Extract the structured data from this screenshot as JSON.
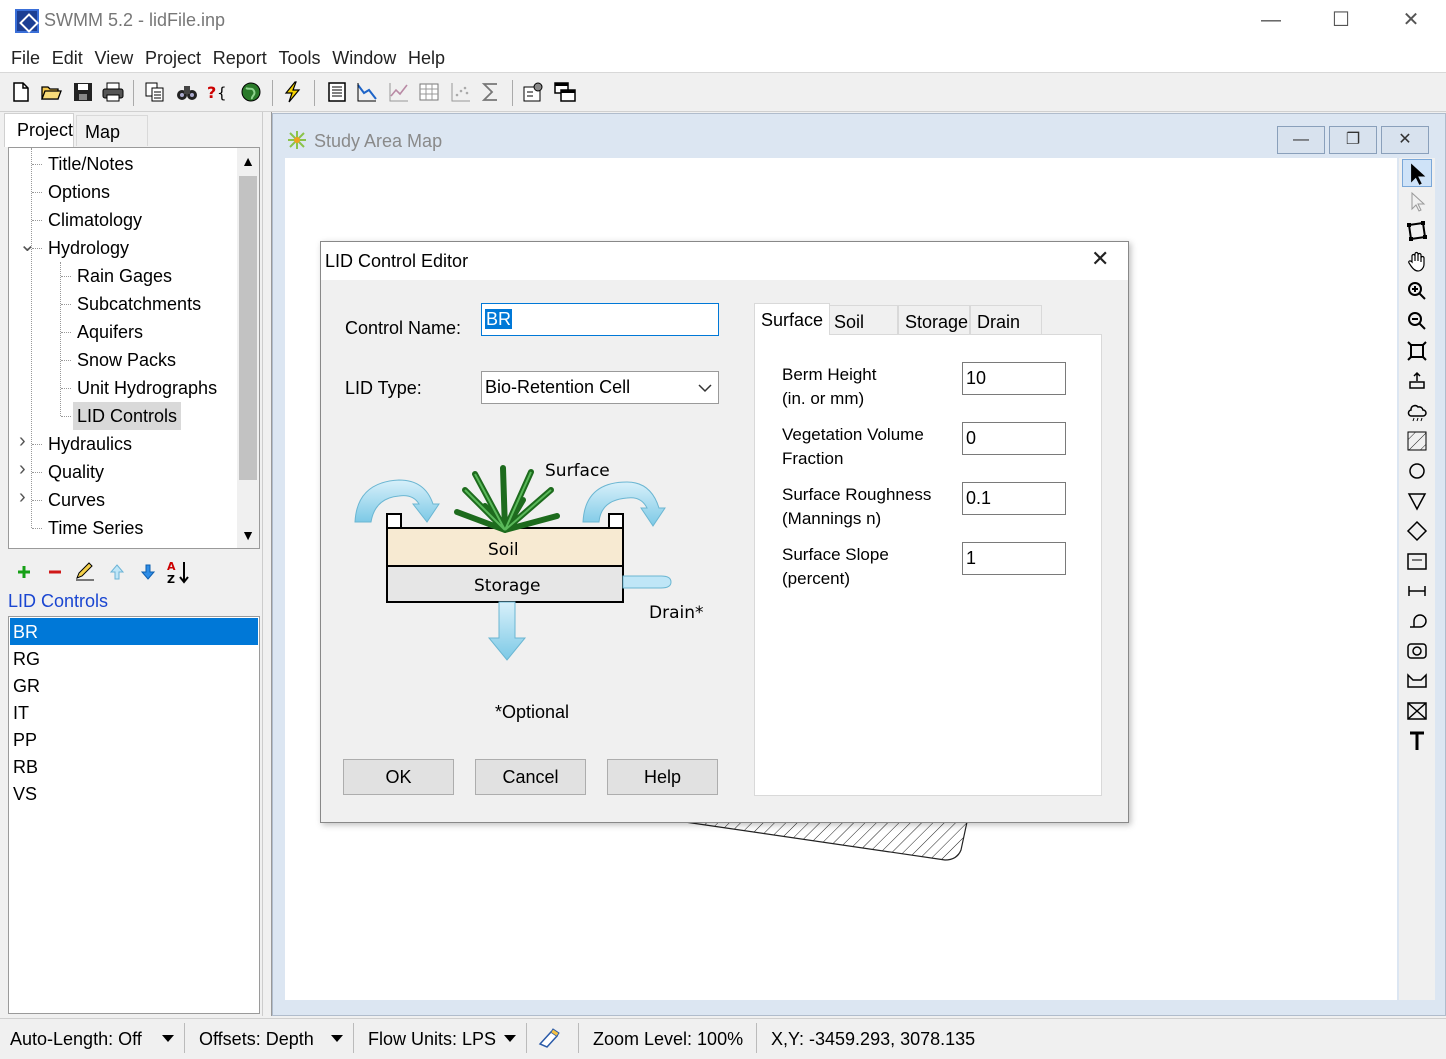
{
  "window": {
    "title": "SWMM 5.2 - lidFile.inp",
    "minimize": "—",
    "maximize": "☐",
    "close": "✕"
  },
  "menu": [
    "File",
    "Edit",
    "View",
    "Project",
    "Report",
    "Tools",
    "Window",
    "Help"
  ],
  "toolbar_icons": [
    "new-file-icon",
    "open-folder-icon",
    "save-icon",
    "print-icon",
    "copy-icon",
    "find-icon",
    "query-icon",
    "overview-map-icon",
    "run-icon",
    "status-report-icon",
    "profile-plot-icon",
    "time-series-plot-icon",
    "table-icon",
    "scatter-plot-icon",
    "statistics-icon",
    "options-icon",
    "arrange-windows-icon"
  ],
  "left_panel": {
    "tabs": [
      "Project",
      "Map"
    ],
    "tree": [
      {
        "label": "Title/Notes",
        "level": 0
      },
      {
        "label": "Options",
        "level": 0
      },
      {
        "label": "Climatology",
        "level": 0
      },
      {
        "label": "Hydrology",
        "level": 0,
        "expanded": true
      },
      {
        "label": "Rain Gages",
        "level": 1
      },
      {
        "label": "Subcatchments",
        "level": 1
      },
      {
        "label": "Aquifers",
        "level": 1
      },
      {
        "label": "Snow Packs",
        "level": 1
      },
      {
        "label": "Unit Hydrographs",
        "level": 1
      },
      {
        "label": "LID Controls",
        "level": 1,
        "selected": true
      },
      {
        "label": "Hydraulics",
        "level": 0,
        "expandable": true
      },
      {
        "label": "Quality",
        "level": 0,
        "expandable": true
      },
      {
        "label": "Curves",
        "level": 0,
        "expandable": true
      },
      {
        "label": "Time Series",
        "level": 0
      }
    ],
    "object_toolbar": [
      "add-icon",
      "delete-icon",
      "edit-icon",
      "move-up-icon",
      "move-down-icon",
      "sort-icon"
    ],
    "list_title": "LID Controls",
    "list_items": [
      "BR",
      "RG",
      "GR",
      "IT",
      "PP",
      "RB",
      "VS"
    ],
    "selected_item": "BR"
  },
  "map_window": {
    "title": "Study Area Map",
    "minimize": "—",
    "restore": "❐",
    "close": "✕",
    "tools": [
      "select-object-icon",
      "select-vertex-icon",
      "select-region-icon",
      "pan-icon",
      "zoom-in-icon",
      "zoom-out-icon",
      "full-extent-icon",
      "rain-gage-icon",
      "subcatchment-cloud-icon",
      "subcatchment-icon",
      "junction-icon",
      "outfall-icon",
      "divider-icon",
      "storage-icon",
      "conduit-icon",
      "pump-icon",
      "orifice-icon",
      "weir-icon",
      "outlet-icon",
      "label-icon"
    ]
  },
  "dialog": {
    "title": "LID Control Editor",
    "close": "✕",
    "control_name_label": "Control Name:",
    "control_name_value": "BR",
    "lid_type_label": "LID Type:",
    "lid_type_value": "Bio-Retention Cell",
    "diagram": {
      "surface": "Surface",
      "soil": "Soil",
      "storage": "Storage",
      "drain": "Drain*",
      "note": "*Optional"
    },
    "buttons": {
      "ok": "OK",
      "cancel": "Cancel",
      "help": "Help"
    },
    "tabs": [
      "Surface",
      "Soil",
      "Storage",
      "Drain"
    ],
    "active_tab": "Surface",
    "params": [
      {
        "label": "Berm Height",
        "unit": "(in. or mm)",
        "value": "10"
      },
      {
        "label": "Vegetation Volume",
        "unit": "Fraction",
        "value": "0"
      },
      {
        "label": "Surface Roughness",
        "unit": "(Mannings n)",
        "value": "0.1"
      },
      {
        "label": "Surface Slope",
        "unit": "(percent)",
        "value": "1"
      }
    ]
  },
  "status_bar": {
    "auto_length": "Auto-Length: Off",
    "offsets": "Offsets: Depth",
    "flow_units": "Flow Units: LPS",
    "zoom": "Zoom Level: 100%",
    "xy": "X,Y: -3459.293, 3078.135"
  },
  "colors": {
    "selection": "#0078d7",
    "link_blue": "#1a46d1",
    "map_frame": "#dce6f2",
    "water": "#8fd0e8",
    "soil": "#f7ead2"
  }
}
